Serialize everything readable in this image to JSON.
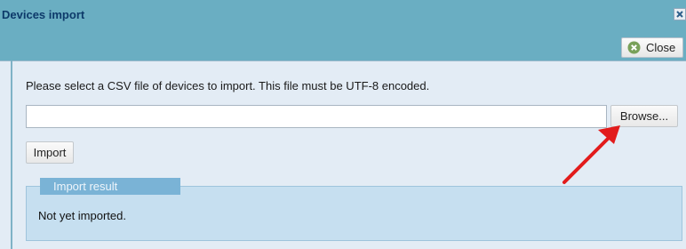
{
  "dialog": {
    "title": "Devices import",
    "close_label": "Close"
  },
  "form": {
    "instructions": "Please select a CSV file of devices to import. This file must be UTF-8 encoded.",
    "file_value": "",
    "browse_label": "Browse...",
    "import_label": "Import"
  },
  "result": {
    "legend": "Import result",
    "text": "Not yet imported."
  },
  "colors": {
    "titlebar": "#6aaec2",
    "legend": "#7ab3d6",
    "result_panel": "#c6dff0",
    "annotation_arrow": "#e21b1b"
  }
}
